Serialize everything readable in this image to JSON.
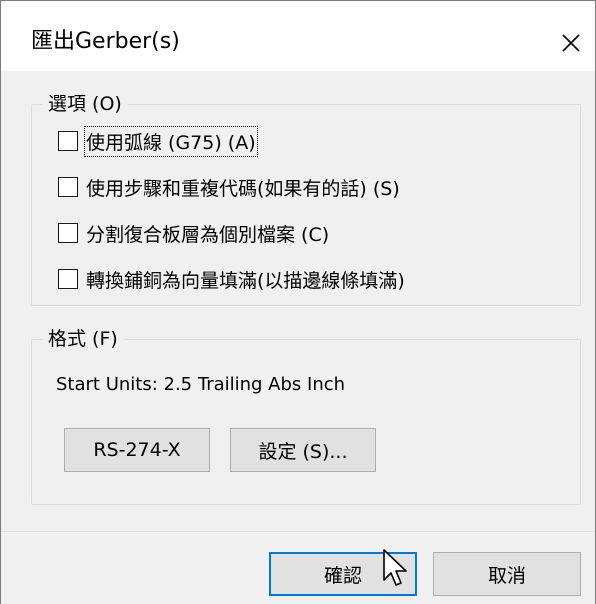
{
  "window": {
    "title": "匯出Gerber(s)",
    "close_icon": "close-icon"
  },
  "options_group": {
    "legend": "選項 (O)",
    "items": [
      {
        "label": "使用弧線 (G75) (A)",
        "checked": false,
        "focused": true
      },
      {
        "label": "使用步驟和重複代碼(如果有的話) (S)",
        "checked": false,
        "focused": false
      },
      {
        "label": "分割復合板層為個別檔案 (C)",
        "checked": false,
        "focused": false
      },
      {
        "label": "轉換鋪銅為向量填滿(以描邊線條填滿)",
        "checked": false,
        "focused": false
      }
    ]
  },
  "format_group": {
    "legend": "格式 (F)",
    "info": "Start Units: 2.5 Trailing Abs Inch",
    "format_button": "RS-274-X",
    "settings_button": "設定 (S)..."
  },
  "footer": {
    "ok_button": "確認",
    "cancel_button": "取消"
  },
  "colors": {
    "dialog_bg": "#f0f0f0",
    "button_bg": "#e1e1e1",
    "primary_border": "#0078d7"
  }
}
